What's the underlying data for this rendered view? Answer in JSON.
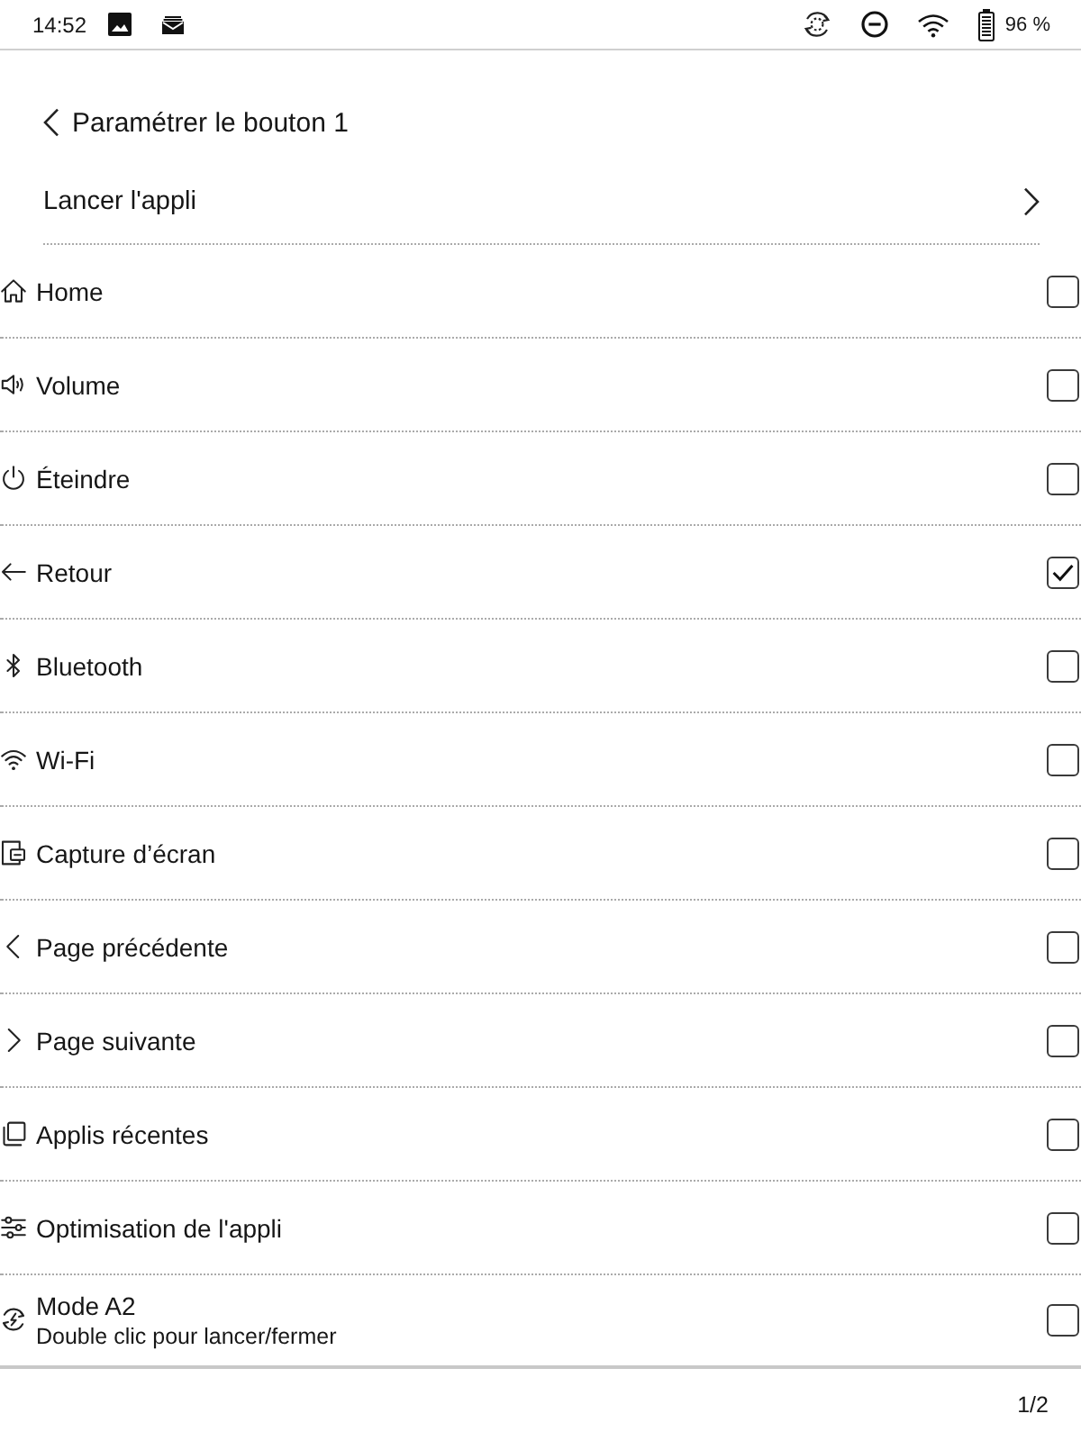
{
  "status_bar": {
    "time": "14:52",
    "battery": "96 %"
  },
  "header": {
    "title": "Paramétrer le bouton 1"
  },
  "launch_app": {
    "label": "Lancer l'appli"
  },
  "options": [
    {
      "label": "Home",
      "checked": false
    },
    {
      "label": "Volume",
      "checked": false
    },
    {
      "label": "Éteindre",
      "checked": false
    },
    {
      "label": "Retour",
      "checked": true
    },
    {
      "label": "Bluetooth",
      "checked": false
    },
    {
      "label": "Wi-Fi",
      "checked": false
    },
    {
      "label": "Capture d’écran",
      "checked": false
    },
    {
      "label": "Page précédente",
      "checked": false
    },
    {
      "label": "Page suivante",
      "checked": false
    },
    {
      "label": "Applis récentes",
      "checked": false
    },
    {
      "label": "Optimisation de l'appli",
      "checked": false
    },
    {
      "label": "Mode A2",
      "subtitle": "Double clic pour lancer/fermer",
      "checked": false
    }
  ],
  "pagination": "1/2"
}
